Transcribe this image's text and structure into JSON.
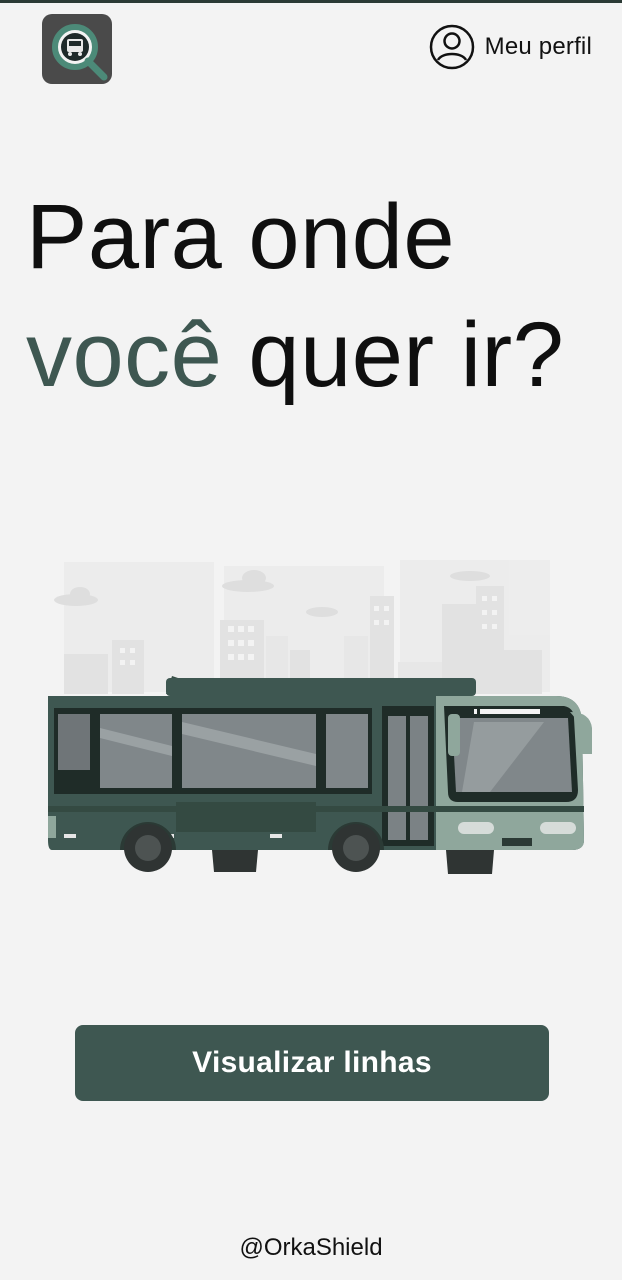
{
  "header": {
    "logo_icon": "bus-search-logo-icon",
    "profile_icon": "user-circle-icon",
    "profile_label": "Meu perfil"
  },
  "hero": {
    "title_line1": "Para onde",
    "title_accent": "você",
    "title_line2_rest": " quer ir?"
  },
  "illustration": {
    "icon": "bus-city-illustration"
  },
  "actions": {
    "view_lines_label": "Visualizar linhas"
  },
  "footer": {
    "handle": "@OrkaShield"
  },
  "colors": {
    "accent": "#3e5751",
    "background": "#f3f3f3"
  }
}
